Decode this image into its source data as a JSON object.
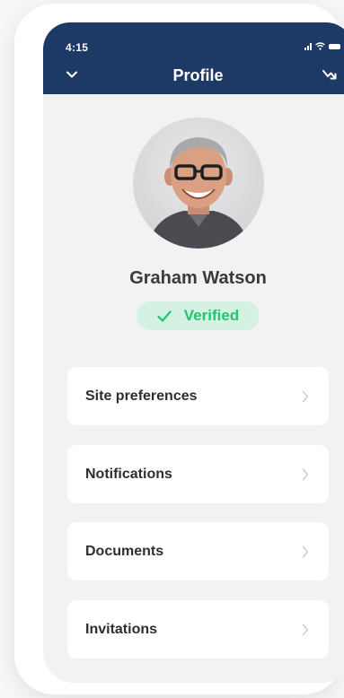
{
  "status_bar": {
    "time": "4:15"
  },
  "header": {
    "title": "Profile",
    "left_icon": "chevron-down-icon",
    "right_icon": "arrow-trend-icon",
    "background": "#1d3a66"
  },
  "profile": {
    "name": "Graham Watson",
    "verified_label": "Verified",
    "verified_color": "#22c46e",
    "verified_bg": "#d5f1e3"
  },
  "menu": {
    "items": [
      {
        "label": "Site preferences"
      },
      {
        "label": "Notifications"
      },
      {
        "label": "Documents"
      },
      {
        "label": "Invitations"
      }
    ]
  }
}
